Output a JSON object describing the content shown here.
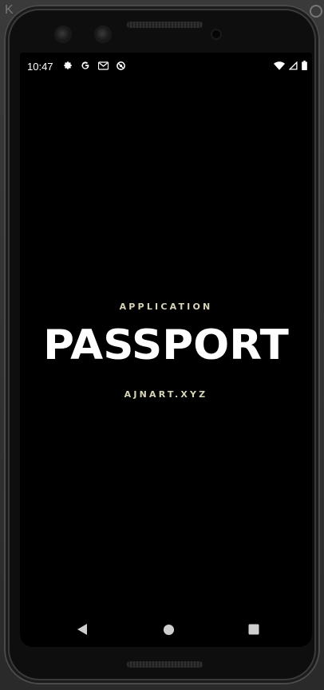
{
  "status_bar": {
    "time": "10:47",
    "left_icons": [
      "settings-icon",
      "google-icon",
      "gmail-icon",
      "data-saver-icon"
    ],
    "right_icons": [
      "wifi-icon",
      "cell-signal-icon",
      "battery-icon"
    ]
  },
  "splash": {
    "subtitle": "APPLICATION",
    "title": "PASSPORT",
    "link": "AJNART.XYZ"
  },
  "colors": {
    "background": "#000000",
    "title": "#ffffff",
    "accent_text": "#d7d4b8"
  },
  "nav_bar": {
    "buttons": [
      "back-icon",
      "home-icon",
      "recents-icon"
    ]
  }
}
